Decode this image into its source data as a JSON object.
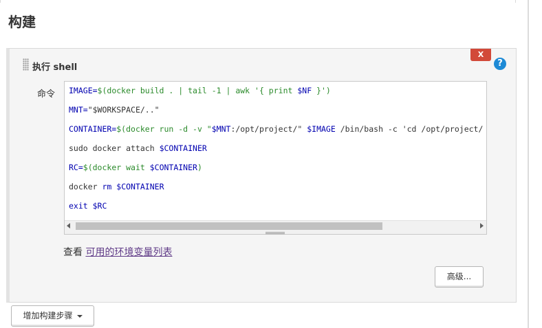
{
  "section": {
    "title": "构建"
  },
  "step": {
    "title": "执行 shell",
    "delete_label": "X",
    "help_label": "?",
    "command_label": "命令",
    "code_lines": [
      [
        {
          "t": "IMAGE=",
          "c": "var"
        },
        {
          "t": "$(docker build . | tail -1 | awk '{ print ",
          "c": "sym"
        },
        {
          "t": "$NF",
          "c": "var"
        },
        {
          "t": " }')",
          "c": "sym"
        }
      ],
      [
        {
          "t": "MNT=",
          "c": "var"
        },
        {
          "t": "\"$WORKSPACE/..\"",
          "c": "plain"
        }
      ],
      [
        {
          "t": "CONTAINER=",
          "c": "var"
        },
        {
          "t": "$(docker run -d -v \"",
          "c": "sym"
        },
        {
          "t": "$MNT",
          "c": "var"
        },
        {
          "t": ":/opt/project/\" ",
          "c": "plain"
        },
        {
          "t": "$IMAGE",
          "c": "var"
        },
        {
          "t": " /bin/bash -c 'cd /opt/project/",
          "c": "plain"
        }
      ],
      [
        {
          "t": "sudo docker attach ",
          "c": "plain"
        },
        {
          "t": "$CONTAINER",
          "c": "var"
        }
      ],
      [
        {
          "t": "RC=",
          "c": "var"
        },
        {
          "t": "$(docker wait ",
          "c": "sym"
        },
        {
          "t": "$CONTAINER",
          "c": "var"
        },
        {
          "t": ")",
          "c": "sym"
        }
      ],
      [
        {
          "t": "docker ",
          "c": "plain"
        },
        {
          "t": "rm",
          "c": "var"
        },
        {
          "t": " ",
          "c": "plain"
        },
        {
          "t": "$CONTAINER",
          "c": "var"
        }
      ],
      [
        {
          "t": "exit ",
          "c": "var"
        },
        {
          "t": "$RC",
          "c": "var"
        }
      ]
    ],
    "env_prefix": "查看 ",
    "env_link": "可用的环境变量列表",
    "advanced_label": "高级..."
  },
  "add_step": {
    "label": "增加构建步骤"
  },
  "colors": {
    "delete": "#d24939",
    "help": "#1d8ad6",
    "link": "#5f3a87",
    "code_var": "#0000b0",
    "code_sym": "#2a8a2a"
  }
}
